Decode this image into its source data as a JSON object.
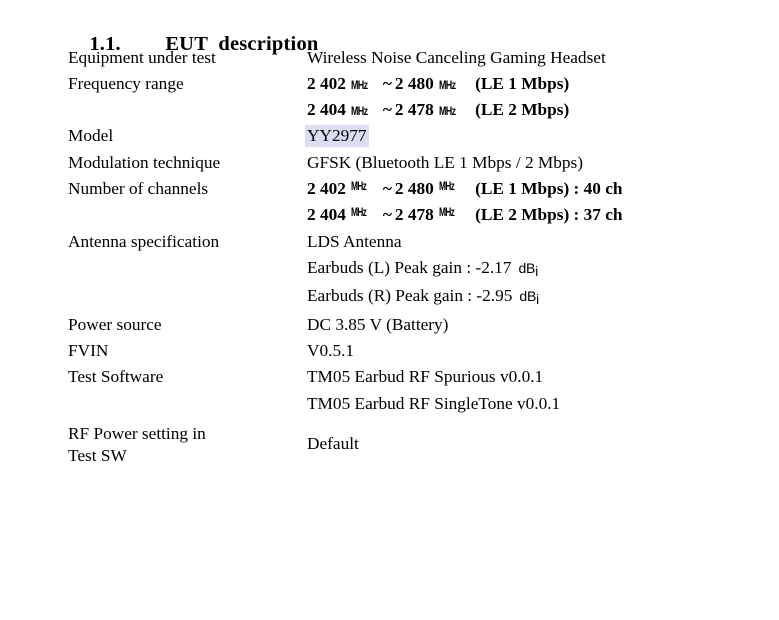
{
  "heading": {
    "number": "1.1.",
    "title": "EUT  description"
  },
  "colors": {
    "highlight": "#dcdcf2",
    "text": "#000000",
    "background": "#ffffff"
  },
  "units": {
    "mhz": "MHz",
    "dbi_main": "dB",
    "dbi_sub": "i",
    "tilde": "~"
  },
  "rows": [
    {
      "label": "Equipment under test",
      "values": [
        {
          "text": "Wireless Noise Canceling Gaming Headset"
        }
      ]
    },
    {
      "label": "Frequency range",
      "values": [
        {
          "bold": true,
          "freq_low": "2 402",
          "freq_high": "2 480",
          "suffix": "(LE 1 Mbps)"
        },
        {
          "bold": true,
          "freq_low": "2 404",
          "freq_high": "2 478",
          "suffix": "(LE 2 Mbps)"
        }
      ]
    },
    {
      "label": "Model",
      "values": [
        {
          "text": "YY2977",
          "highlighted": true
        }
      ]
    },
    {
      "label": "Modulation technique",
      "values": [
        {
          "text": "GFSK (Bluetooth LE 1 Mbps / 2 Mbps)"
        }
      ]
    },
    {
      "label": "Number of channels",
      "values": [
        {
          "bold": true,
          "freq_low": "2 402",
          "freq_high": "2 480",
          "suffix": "(LE 1 Mbps) : 40 ch"
        },
        {
          "bold": true,
          "freq_low": "2 404",
          "freq_high": "2 478",
          "suffix": "(LE 2 Mbps) : 37 ch"
        }
      ]
    },
    {
      "label": "Antenna specification",
      "values": [
        {
          "text": "LDS Antenna"
        },
        {
          "text": "Earbuds (L) Peak gain : -2.17",
          "unit": "dBi"
        },
        {
          "text": "Earbuds (R) Peak gain : -2.95",
          "unit": "dBi"
        }
      ]
    },
    {
      "label": "Power source",
      "values": [
        {
          "text": "DC 3.85 V (Battery)"
        }
      ]
    },
    {
      "label": "FVIN",
      "values": [
        {
          "text": "V0.5.1"
        }
      ]
    },
    {
      "label": "Test Software",
      "values": [
        {
          "text": "TM05 Earbud RF Spurious v0.0.1"
        },
        {
          "text": "TM05 Earbud RF SingleTone v0.0.1"
        }
      ]
    },
    {
      "label": "RF Power setting in\nTest SW",
      "label_lines": [
        "RF Power setting in",
        "Test SW"
      ],
      "values": [
        {
          "text": "Default",
          "vcenter": true
        }
      ]
    }
  ]
}
